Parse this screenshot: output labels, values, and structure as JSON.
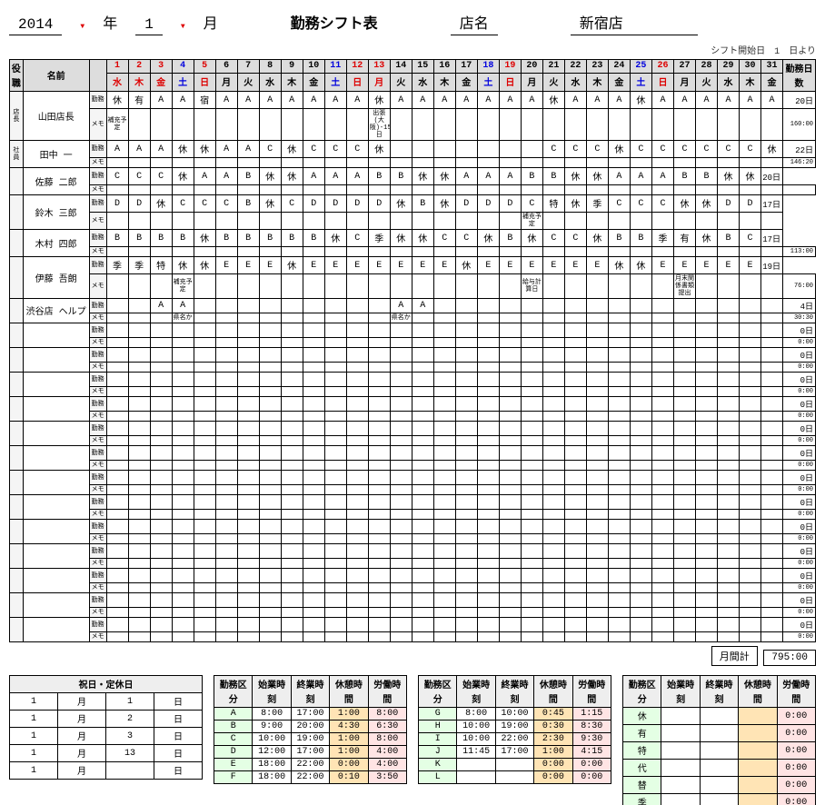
{
  "header": {
    "year": "2014",
    "ylab": "年",
    "month": "1",
    "mlab": "月",
    "title": "勤務シフト表",
    "storelab": "店名",
    "store": "新宿店",
    "start": "シフト開始日　1　日より"
  },
  "cols": {
    "role": "役職",
    "name": "名前",
    "sub": "",
    "total": "勤務日数"
  },
  "days": [
    1,
    2,
    3,
    4,
    5,
    6,
    7,
    8,
    9,
    10,
    11,
    12,
    13,
    14,
    15,
    16,
    17,
    18,
    19,
    20,
    21,
    22,
    23,
    24,
    25,
    26,
    27,
    28,
    29,
    30,
    31
  ],
  "wd": [
    "水",
    "木",
    "金",
    "土",
    "日",
    "月",
    "火",
    "水",
    "木",
    "金",
    "土",
    "日",
    "月",
    "火",
    "水",
    "木",
    "金",
    "土",
    "日",
    "月",
    "火",
    "水",
    "木",
    "金",
    "土",
    "日",
    "月",
    "火",
    "水",
    "木",
    "金"
  ],
  "wdcolor": [
    "r",
    "r",
    "r",
    "b",
    "r",
    "",
    "",
    "",
    "",
    "",
    "b",
    "r",
    "r",
    "",
    "",
    "",
    "",
    "b",
    "r",
    "",
    "",
    "",
    "",
    "",
    "b",
    "r",
    "",
    "",
    "",
    "",
    ""
  ],
  "sublabels": [
    "勤務",
    "メモ"
  ],
  "staff": [
    {
      "role": "店長",
      "name": "山田店長",
      "s": [
        "休",
        "有",
        "A",
        "A",
        "宿",
        "A",
        "A",
        "A",
        "A",
        "A",
        "A",
        "A",
        "休",
        "A",
        "A",
        "A",
        "A",
        "A",
        "A",
        "A",
        "休",
        "A",
        "A",
        "A",
        "休",
        "A",
        "A",
        "A",
        "A",
        "A",
        "A"
      ],
      "n": [
        "補充予定",
        "",
        "",
        "",
        "",
        "",
        "",
        "",
        "",
        "",
        "",
        "",
        "出張(大阪)-15日",
        "",
        "",
        "",
        "",
        "",
        "",
        "",
        "",
        "",
        "",
        "",
        "",
        "",
        "",
        "",
        "",
        "",
        ""
      ],
      "t": "20日",
      "h": "160:00"
    },
    {
      "role": "社員",
      "name": "田中 一",
      "s": [
        "A",
        "A",
        "A",
        "休",
        "休",
        "A",
        "A",
        "C",
        "休",
        "C",
        "C",
        "C",
        "休",
        "",
        "",
        "",
        "",
        "",
        "",
        "",
        "C",
        "C",
        "C",
        "休",
        "C",
        "C",
        "C",
        "C",
        "C",
        "C",
        "休"
      ],
      "n": [
        "",
        "",
        "",
        "",
        "",
        "",
        "",
        "",
        "",
        "",
        "",
        "",
        "",
        "",
        "",
        "",
        "",
        "",
        "",
        "",
        "",
        "",
        "",
        "",
        "",
        "",
        "",
        "",
        "",
        "",
        ""
      ],
      "t": "22日",
      "h": "146:20"
    },
    {
      "role": "",
      "name": "佐藤 二郎",
      "s": [
        "C",
        "C",
        "C",
        "休",
        "A",
        "A",
        "B",
        "休",
        "休",
        "A",
        "A",
        "A",
        "B",
        "B",
        "休",
        "休",
        "A",
        "A",
        "A",
        "B",
        "B",
        "休",
        "休",
        "A",
        "A",
        "A",
        "B",
        "B",
        "休",
        "休"
      ],
      "n": [
        "",
        "",
        "",
        "",
        "",
        "",
        "",
        "",
        "",
        "",
        "",
        "",
        "",
        "",
        "",
        "",
        "",
        "",
        "",
        "",
        "",
        "",
        "",
        "",
        "",
        "",
        "",
        "",
        "",
        "",
        ""
      ],
      "t": "20日",
      "h": ""
    },
    {
      "role": "",
      "name": "鈴木 三郎",
      "s": [
        "D",
        "D",
        "休",
        "C",
        "C",
        "C",
        "B",
        "休",
        "C",
        "D",
        "D",
        "D",
        "D",
        "休",
        "B",
        "休",
        "D",
        "D",
        "D",
        "C",
        "特",
        "休",
        "季",
        "C",
        "C",
        "C",
        "休",
        "休",
        "D",
        "D"
      ],
      "n": [
        "",
        "",
        "",
        "",
        "",
        "",
        "",
        "",
        "",
        "",
        "",
        "",
        "",
        "",
        "",
        "",
        "",
        "",
        "",
        "補充予定",
        "",
        "",
        "",
        "",
        "",
        "",
        "",
        "",
        "",
        ""
      ],
      "t": "17日",
      "h": ""
    },
    {
      "role": "",
      "name": "木村 四郎",
      "s": [
        "B",
        "B",
        "B",
        "B",
        "休",
        "B",
        "B",
        "B",
        "B",
        "B",
        "休",
        "C",
        "季",
        "休",
        "休",
        "C",
        "C",
        "休",
        "B",
        "休",
        "C",
        "C",
        "休",
        "B",
        "B",
        "季",
        "有",
        "休",
        "B",
        "C"
      ],
      "n": [
        "",
        "",
        "",
        "",
        "",
        "",
        "",
        "",
        "",
        "",
        "",
        "",
        "",
        "",
        "",
        "",
        "",
        "",
        "",
        "",
        "",
        "",
        "",
        "",
        "",
        "",
        "",
        "",
        "",
        "",
        ""
      ],
      "t": "17日",
      "h": "113:00"
    },
    {
      "role": "",
      "name": "伊藤 吾朗",
      "s": [
        "季",
        "季",
        "特",
        "休",
        "休",
        "E",
        "E",
        "E",
        "休",
        "E",
        "E",
        "E",
        "E",
        "E",
        "E",
        "E",
        "休",
        "E",
        "E",
        "E",
        "E",
        "E",
        "E",
        "休",
        "休",
        "E",
        "E",
        "E",
        "E",
        "E"
      ],
      "n": [
        "",
        "",
        "",
        "補充予定",
        "",
        "",
        "",
        "",
        "",
        "",
        "",
        "",
        "",
        "",
        "",
        "",
        "",
        "",
        "",
        "給与計算日",
        "",
        "",
        "",
        "",
        "",
        "",
        "月末関係書類提出",
        "",
        "",
        "",
        ""
      ],
      "t": "19日",
      "h": "76:00"
    },
    {
      "role": "",
      "name": "渋谷店 ヘルプ",
      "s": [
        "",
        "",
        "A",
        "A",
        "",
        "",
        "",
        "",
        "",
        "",
        "",
        "",
        "",
        "A",
        "A",
        "",
        "",
        "",
        "",
        "",
        "",
        "",
        "",
        "",
        "",
        "",
        "",
        "",
        "",
        "",
        ""
      ],
      "n": [
        "",
        "",
        "",
        "県名か",
        "",
        "",
        "",
        "",
        "",
        "",
        "",
        "",
        "",
        "県名か",
        "",
        "",
        "",
        "",
        "",
        "",
        "",
        "",
        "",
        "",
        "",
        "",
        "",
        "",
        "",
        "",
        ""
      ],
      "t": "4日",
      "h": "30:30"
    }
  ],
  "empty_rows": 13,
  "empty_total": "0日",
  "empty_hours": "0:00",
  "monthTotal": {
    "label": "月間計",
    "value": "795:00"
  },
  "holHdr": "祝日・定休日",
  "holidays": [
    [
      "1",
      "月",
      "1",
      "日"
    ],
    [
      "1",
      "月",
      "2",
      "日"
    ],
    [
      "1",
      "月",
      "3",
      "日"
    ],
    [
      "1",
      "月",
      "13",
      "日"
    ],
    [
      "1",
      "月",
      "",
      "日"
    ]
  ],
  "legendHdr": [
    "勤務区分",
    "始業時刻",
    "終業時刻",
    "休憩時間",
    "労働時間"
  ],
  "legend1": [
    [
      "A",
      "8:00",
      "17:00",
      "1:00",
      "8:00"
    ],
    [
      "B",
      "9:00",
      "20:00",
      "4:30",
      "6:30"
    ],
    [
      "C",
      "10:00",
      "19:00",
      "1:00",
      "8:00"
    ],
    [
      "D",
      "12:00",
      "17:00",
      "1:00",
      "4:00"
    ],
    [
      "E",
      "18:00",
      "22:00",
      "0:00",
      "4:00"
    ],
    [
      "F",
      "18:00",
      "22:00",
      "0:10",
      "3:50"
    ]
  ],
  "legend2": [
    [
      "G",
      "8:00",
      "10:00",
      "0:45",
      "1:15"
    ],
    [
      "H",
      "10:00",
      "19:00",
      "0:30",
      "8:30"
    ],
    [
      "I",
      "10:00",
      "22:00",
      "2:30",
      "9:30"
    ],
    [
      "J",
      "11:45",
      "17:00",
      "1:00",
      "4:15"
    ],
    [
      "K",
      "",
      "",
      "0:00",
      "0:00"
    ],
    [
      "L",
      "",
      "",
      "0:00",
      "0:00"
    ]
  ],
  "legend3": [
    [
      "休",
      "",
      "",
      "",
      "0:00"
    ],
    [
      "有",
      "",
      "",
      "",
      "0:00"
    ],
    [
      "特",
      "",
      "",
      "",
      "0:00"
    ],
    [
      "代",
      "",
      "",
      "",
      "0:00"
    ],
    [
      "替",
      "",
      "",
      "",
      "0:00"
    ],
    [
      "季",
      "",
      "",
      "",
      "0:00"
    ]
  ]
}
